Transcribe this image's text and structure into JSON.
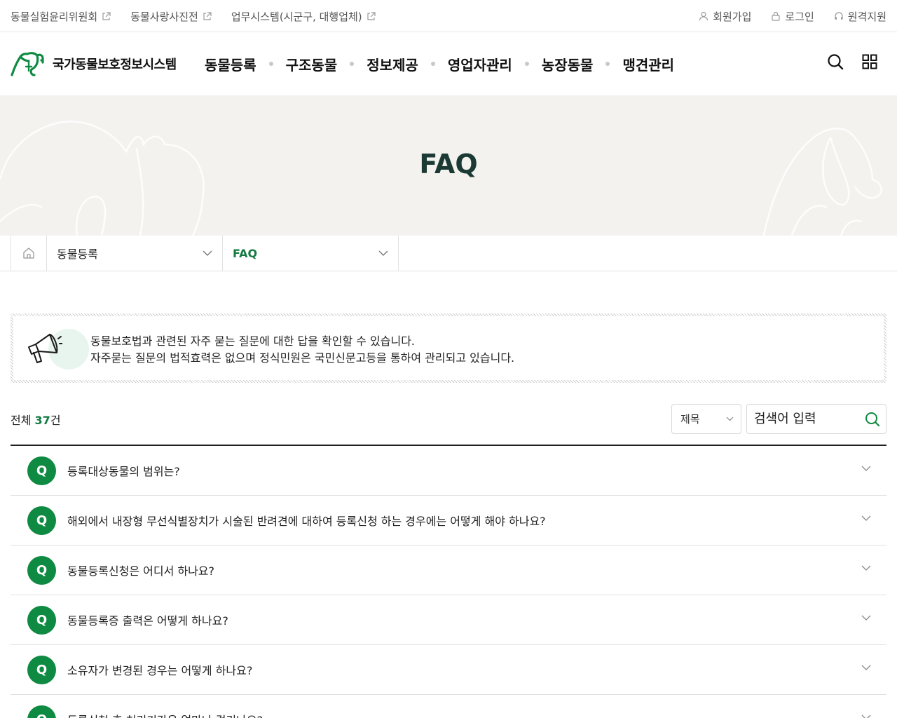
{
  "topbar": {
    "left_links": [
      {
        "label": "동물실험윤리위원회"
      },
      {
        "label": "동물사랑사진전"
      },
      {
        "label": "업무시스템(시군구, 대행업체)"
      }
    ],
    "signup_label": "회원가입",
    "login_label": "로그인",
    "remote_label": "원격지원"
  },
  "header": {
    "logo_text": "국가동물보호정보시스템",
    "nav": [
      "동물등록",
      "구조동물",
      "정보제공",
      "영업자관리",
      "농장동물",
      "맹견관리"
    ]
  },
  "hero": {
    "title": "FAQ"
  },
  "breadcrumb": {
    "level1": "동물등록",
    "level2": "FAQ"
  },
  "notice": {
    "line1": "동물보호법과 관련된 자주 묻는 질문에 대한 답을 확인할 수 있습니다.",
    "line2": "자주묻는 질문의 법적효력은 없으며 정식민원은 국민신문고등을 통하여 관리되고 있습니다."
  },
  "list": {
    "count_prefix": "전체",
    "count": "37",
    "count_suffix": "건",
    "search_type": "제목",
    "search_placeholder": "검색어 입력",
    "q_badge": "Q",
    "items": [
      {
        "title": "등록대상동물의 범위는?"
      },
      {
        "title": "해외에서 내장형 무선식별장치가 시술된 반려견에 대하여 등록신청 하는 경우에는 어떻게 해야 하나요?"
      },
      {
        "title": "동물등록신청은 어디서 하나요?"
      },
      {
        "title": "동물등록증 출력은 어떻게 하나요?"
      },
      {
        "title": "소유자가 변경된 경우는 어떻게 하나요?"
      },
      {
        "title": "등록신청 후 처리기간은 얼마나 걸리나요?"
      }
    ]
  },
  "colors": {
    "accent": "#0f8a42",
    "hero_bg": "#f3f2ef",
    "title_dark": "#1a3a33"
  }
}
